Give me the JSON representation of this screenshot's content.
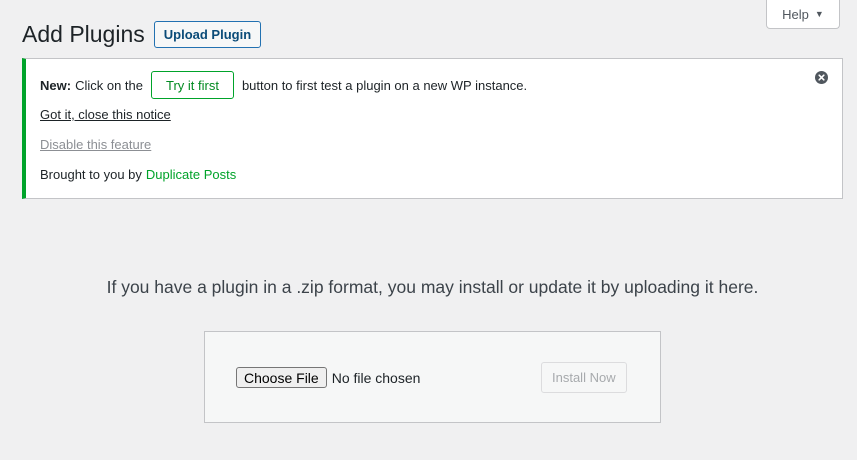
{
  "help_tab": {
    "label": "Help",
    "caret": "▼"
  },
  "header": {
    "title": "Add Plugins",
    "upload_button": "Upload Plugin"
  },
  "notice": {
    "prefix_bold": "New:",
    "text_before_button": "Click on the",
    "try_button": "Try it first",
    "text_after_button": "button to first test a plugin on a new WP instance.",
    "close_link": "Got it, close this notice",
    "disable_link": "Disable this feature",
    "credit_text": "Brought to you by",
    "credit_link": "Duplicate Posts",
    "dismiss_icon": "close-circle-icon",
    "accent_color": "#00a32a"
  },
  "upload": {
    "intro": "If you have a plugin in a .zip format, you may install or update it by uploading it here.",
    "choose_file_button": "Choose File",
    "file_status": "No file chosen",
    "install_button": "Install Now"
  }
}
